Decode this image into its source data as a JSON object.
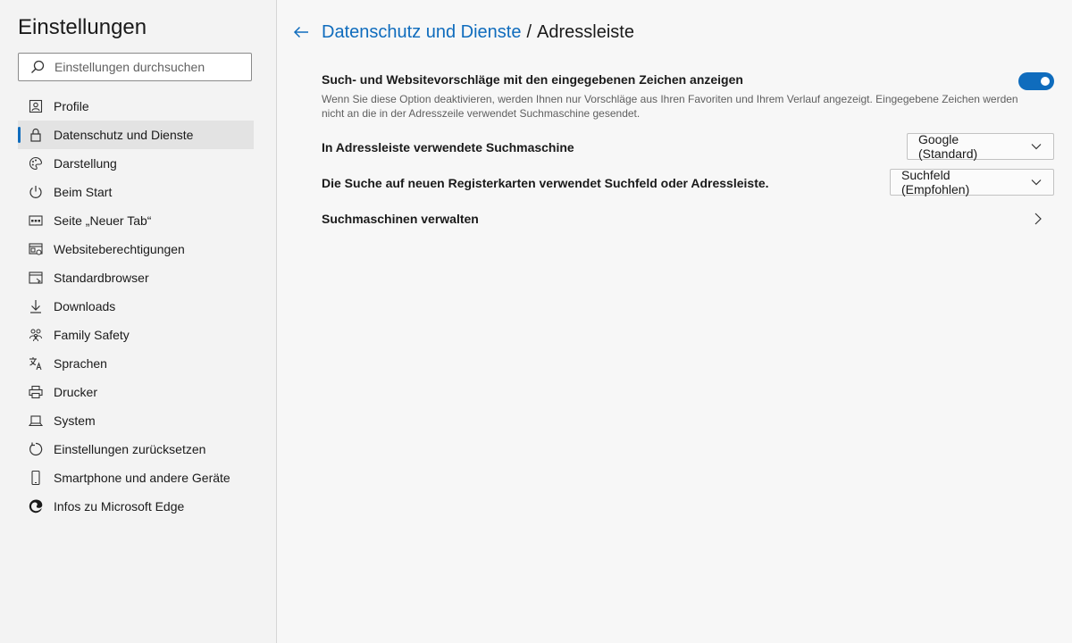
{
  "sidebar": {
    "title": "Einstellungen",
    "search_placeholder": "Einstellungen durchsuchen",
    "items": [
      {
        "label": "Profile",
        "icon": "profile-icon"
      },
      {
        "label": "Datenschutz und Dienste",
        "icon": "lock-icon",
        "selected": true
      },
      {
        "label": "Darstellung",
        "icon": "palette-icon"
      },
      {
        "label": "Beim Start",
        "icon": "power-icon"
      },
      {
        "label": "Seite „Neuer Tab“",
        "icon": "new-tab-icon"
      },
      {
        "label": "Websiteberechtigungen",
        "icon": "site-permissions-icon"
      },
      {
        "label": "Standardbrowser",
        "icon": "default-browser-icon"
      },
      {
        "label": "Downloads",
        "icon": "download-icon"
      },
      {
        "label": "Family Safety",
        "icon": "family-icon"
      },
      {
        "label": "Sprachen",
        "icon": "languages-icon"
      },
      {
        "label": "Drucker",
        "icon": "printer-icon"
      },
      {
        "label": "System",
        "icon": "laptop-icon"
      },
      {
        "label": "Einstellungen zurücksetzen",
        "icon": "reset-icon"
      },
      {
        "label": "Smartphone und andere Geräte",
        "icon": "smartphone-icon"
      },
      {
        "label": "Infos zu Microsoft Edge",
        "icon": "edge-logo-icon"
      }
    ]
  },
  "header": {
    "parent": "Datenschutz und Dienste",
    "separator": "/",
    "current": "Adressleiste"
  },
  "settings": {
    "suggestions": {
      "title": "Such- und Websitevorschläge mit den eingegebenen Zeichen anzeigen",
      "description": "Wenn Sie diese Option deaktivieren, werden Ihnen nur Vorschläge aus Ihren Favoriten und Ihrem Verlauf angezeigt. Eingegebene Zeichen werden nicht an die in der Adresszeile verwendet Suchmaschine gesendet.",
      "enabled": true
    },
    "search_engine": {
      "title": "In Adressleiste verwendete Suchmaschine",
      "value": "Google (Standard)"
    },
    "new_tab_search": {
      "title": "Die Suche auf neuen Registerkarten verwendet Suchfeld oder Adressleiste.",
      "value": "Suchfeld (Empfohlen)"
    },
    "manage": {
      "title": "Suchmaschinen verwalten"
    }
  },
  "colors": {
    "accent": "#0f6cbd",
    "sidebar_bg": "#f3f3f3",
    "content_bg": "#f7f7f7",
    "selected_bg": "#e3e3e3"
  }
}
